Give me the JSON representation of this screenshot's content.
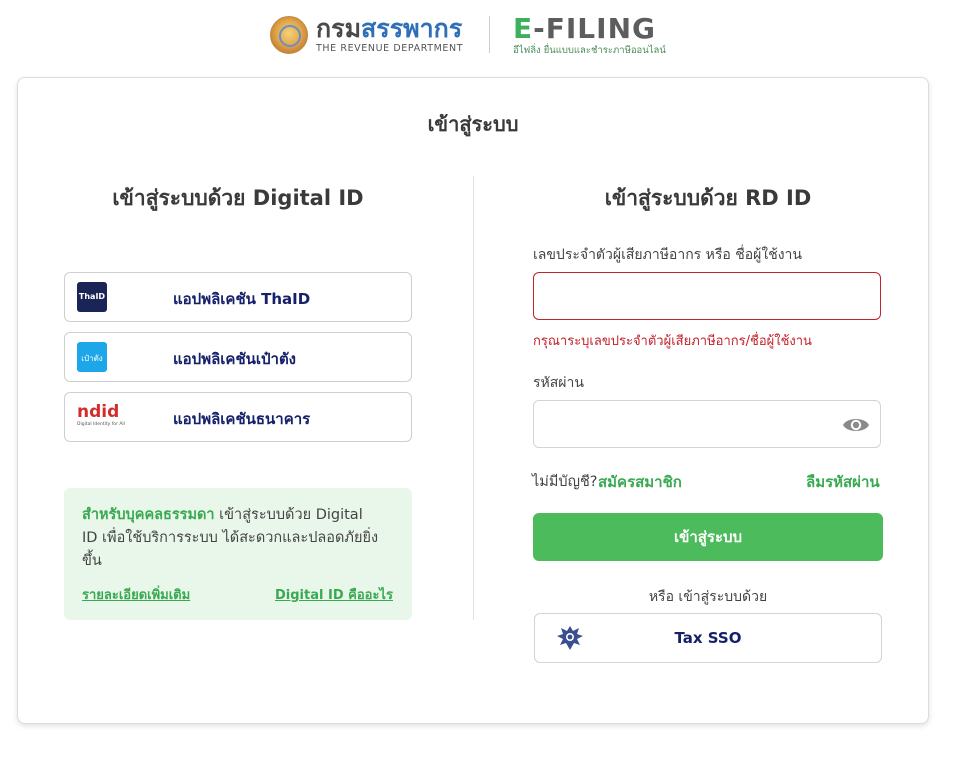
{
  "header": {
    "rd_name_part1": "กรม",
    "rd_name_part2": "สรรพากร",
    "rd_name_en": "THE REVENUE DEPARTMENT",
    "efiling_prefix": "E",
    "efiling_suffix": "-FILING",
    "efiling_sub": "อีไฟลิ่ง ยื่นแบบและชำระภาษีออนไลน์"
  },
  "card": {
    "title": "เข้าสู่ระบบ"
  },
  "digital_id": {
    "title": "เข้าสู่ระบบด้วย Digital ID",
    "apps": [
      {
        "label": "แอปพลิเคชัน ThaID",
        "icon": "thaid-icon",
        "icon_text": "ThaID"
      },
      {
        "label": "แอปพลิเคชันเป๋าตัง",
        "icon": "paotang-icon",
        "icon_text": "เป๋าตัง"
      },
      {
        "label": "แอปพลิเคชันธนาคาร",
        "icon": "ndid-icon",
        "icon_text": "ndid",
        "icon_sub": "Digital Identity for All"
      }
    ],
    "info_highlight": "สำหรับบุคคลธรรมดา",
    "info_text": " เข้าสู่ระบบด้วย Digital ID เพื่อใช้บริการระบบ ได้สะดวกและปลอดภัยยิ่งขึ้น",
    "link_details": "รายละเอียดเพิ่มเติม",
    "link_what_is": "Digital ID คืออะไร"
  },
  "rd_id": {
    "title": "เข้าสู่ระบบด้วย RD ID",
    "username_label": "เลขประจำตัวผู้เสียภาษีอากร หรือ ชื่อผู้ใช้งาน",
    "username_value": "",
    "username_error": "กรุณาระบุเลขประจำตัวผู้เสียภาษีอากร/ชื่อผู้ใช้งาน",
    "password_label": "รหัสผ่าน",
    "password_value": "",
    "no_account": "ไม่มีบัญชี?",
    "register": "สมัครสมาชิก",
    "forgot": "ลืมรหัสผ่าน",
    "login_button": "เข้าสู่ระบบ",
    "or_text": "หรือ เข้าสู่ระบบด้วย",
    "sso_button": "Tax SSO"
  },
  "colors": {
    "green": "#4cbb5b",
    "navy": "#15206b",
    "error": "#c4212b"
  }
}
